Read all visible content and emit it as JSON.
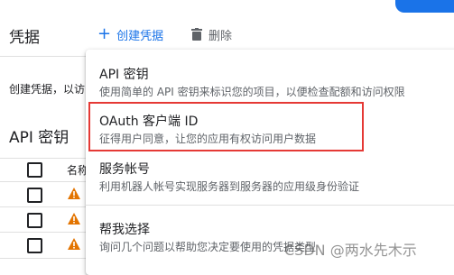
{
  "header": {
    "title": "凭据",
    "create_label": "创建凭据",
    "delete_label": "删除"
  },
  "description": "创建凭据，以访",
  "api_keys_section": {
    "title": "API 密钥",
    "column_name": "名称"
  },
  "menu": {
    "items": [
      {
        "title": "API 密钥",
        "desc": "使用简单的 API 密钥来标识您的项目，以便检查配额和访问权限"
      },
      {
        "title": "OAuth 客户端 ID",
        "desc": "征得用户同意，让您的应用有权访问用户数据"
      },
      {
        "title": "服务帐号",
        "desc": "利用机器人帐号实现服务器到服务器的应用级身份验证"
      },
      {
        "title": "帮我选择",
        "desc": "询问几个问题以帮助您决定要使用的凭据类型"
      }
    ]
  },
  "watermark": "CSDN @两水先木示",
  "colors": {
    "accent": "#1a73e8",
    "highlight": "#e53935",
    "warning": "#e37400"
  }
}
